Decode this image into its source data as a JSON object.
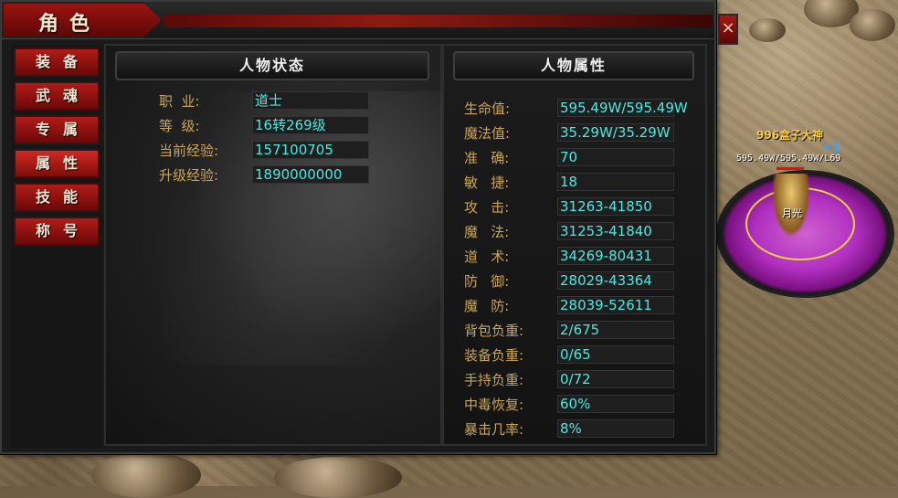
{
  "window": {
    "title": "角色",
    "close_label": "×"
  },
  "tabs": [
    {
      "label": "装备",
      "active": false
    },
    {
      "label": "武魂",
      "active": false
    },
    {
      "label": "专属",
      "active": false
    },
    {
      "label": "属性",
      "active": true
    },
    {
      "label": "技能",
      "active": false
    },
    {
      "label": "称号",
      "active": false
    }
  ],
  "status": {
    "header": "人物状态",
    "rows": [
      {
        "label": "职  业:",
        "value": "道士"
      },
      {
        "label": "等  级:",
        "value": "16转269级"
      },
      {
        "label": "当前经验:",
        "value": "157100705"
      },
      {
        "label": "升级经验:",
        "value": "1890000000"
      }
    ]
  },
  "attributes": {
    "header": "人物属性",
    "rows": [
      {
        "label": "生命值:",
        "value": "595.49W/595.49W"
      },
      {
        "label": "魔法值:",
        "value": "35.29W/35.29W"
      },
      {
        "label": "准   确:",
        "value": "70"
      },
      {
        "label": "敏   捷:",
        "value": "18"
      },
      {
        "label": "攻   击:",
        "value": "31263-41850"
      },
      {
        "label": "魔   法:",
        "value": "31253-41840"
      },
      {
        "label": "道   术:",
        "value": "34269-80431"
      },
      {
        "label": "防   御:",
        "value": "28029-43364"
      },
      {
        "label": "魔   防:",
        "value": "28039-52611"
      },
      {
        "label": "背包负重:",
        "value": "2/675"
      },
      {
        "label": "装备负重:",
        "value": "0/65"
      },
      {
        "label": "手持负重:",
        "value": "0/72"
      },
      {
        "label": "中毒恢复:",
        "value": "60%"
      },
      {
        "label": "暴击几率:",
        "value": "8%"
      }
    ]
  },
  "character": {
    "name": "996盒子大神",
    "hp_text": "595.49W/595.49W/L69",
    "tag": "+1",
    "label": "月光"
  },
  "colors": {
    "label": "#c9a55a",
    "value": "#4fe8e0",
    "tab_red": "#b01c18"
  }
}
